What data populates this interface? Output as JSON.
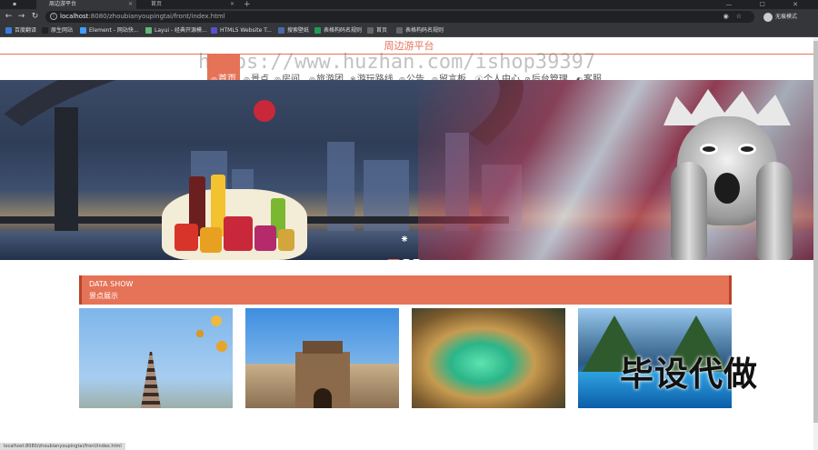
{
  "browser": {
    "tabs": [
      {
        "label": "周边游平台",
        "active": true
      },
      {
        "label": "首页",
        "active": false
      }
    ],
    "new_tab": "+",
    "window_controls": "— ☐ ✕",
    "url_host": "localhost",
    "url_rest": ":8080/zhoubianyoupingtai/front/index.html",
    "profile_label": "无痕模式",
    "bookmarks": [
      {
        "label": "百度翻译",
        "color": "#3a7be0"
      },
      {
        "label": "原生网站",
        "color": "#222222"
      },
      {
        "label": "Element - 网站快...",
        "color": "#409eff"
      },
      {
        "label": "Layui - 经典开源模...",
        "color": "#5fb878"
      },
      {
        "label": "HTML5 Website T...",
        "color": "#5a4fcf"
      },
      {
        "label": "搜索壁纸",
        "color": "#4a6aa5"
      },
      {
        "label": "表格构码名规则",
        "color": "#1f9d55"
      },
      {
        "label": "首页",
        "color": "#666666"
      },
      {
        "label": "表格构码名规则",
        "color": "#666666"
      }
    ]
  },
  "site": {
    "title": "周边游平台",
    "watermark": "https://www.huzhan.com/ishop39397",
    "nav": [
      {
        "icon": "◎",
        "label": "首页",
        "active": true
      },
      {
        "icon": "◎",
        "label": "景点",
        "active": false
      },
      {
        "icon": "◎",
        "label": "房间",
        "active": false
      },
      {
        "icon": "◎",
        "label": "旅游团",
        "active": false
      },
      {
        "icon": "※",
        "label": "游玩路线",
        "active": false
      },
      {
        "icon": "◎",
        "label": "公告",
        "active": false
      },
      {
        "icon": "◎",
        "label": "留言板",
        "active": false
      },
      {
        "icon": "Ⓐ",
        "label": "个人中心",
        "active": false
      },
      {
        "icon": "⊘",
        "label": "后台管理",
        "active": false
      },
      {
        "icon": "◐",
        "label": "客服",
        "active": false
      }
    ]
  },
  "banner": {
    "spinner": "⁕",
    "active_slide": 1,
    "slide_count": 3
  },
  "data_show": {
    "title_en": "DATA SHOW",
    "title_cn": "景点展示"
  },
  "overlay_text": "毕设代做",
  "status_text": "localhost:8080/zhoubianyoupingtai/front/index.html",
  "colors": {
    "accent": "#e57357",
    "chrome_dark": "#202124",
    "chrome_mid": "#35363a"
  }
}
